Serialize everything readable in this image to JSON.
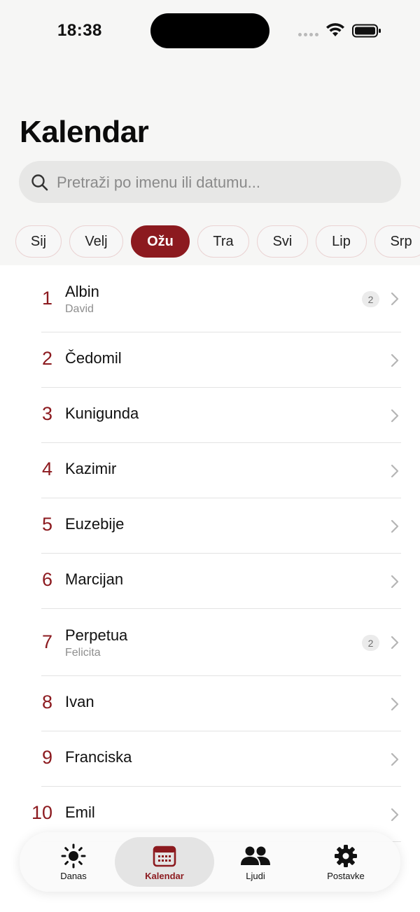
{
  "status": {
    "time": "18:38"
  },
  "header": {
    "title": "Kalendar"
  },
  "search": {
    "placeholder": "Pretraži po imenu ili datumu..."
  },
  "months": [
    {
      "label": "Sij",
      "active": false
    },
    {
      "label": "Velj",
      "active": false
    },
    {
      "label": "Ožu",
      "active": true
    },
    {
      "label": "Tra",
      "active": false
    },
    {
      "label": "Svi",
      "active": false
    },
    {
      "label": "Lip",
      "active": false
    },
    {
      "label": "Srp",
      "active": false
    }
  ],
  "days": [
    {
      "day": "1",
      "name": "Albin",
      "sub": "David",
      "badge": "2"
    },
    {
      "day": "2",
      "name": "Čedomil",
      "sub": "",
      "badge": ""
    },
    {
      "day": "3",
      "name": "Kunigunda",
      "sub": "",
      "badge": ""
    },
    {
      "day": "4",
      "name": "Kazimir",
      "sub": "",
      "badge": ""
    },
    {
      "day": "5",
      "name": "Euzebije",
      "sub": "",
      "badge": ""
    },
    {
      "day": "6",
      "name": "Marcijan",
      "sub": "",
      "badge": ""
    },
    {
      "day": "7",
      "name": "Perpetua",
      "sub": "Felicita",
      "badge": "2"
    },
    {
      "day": "8",
      "name": "Ivan",
      "sub": "",
      "badge": ""
    },
    {
      "day": "9",
      "name": "Franciska",
      "sub": "",
      "badge": ""
    },
    {
      "day": "10",
      "name": "Emil",
      "sub": "",
      "badge": ""
    }
  ],
  "tabs": [
    {
      "label": "Danas",
      "icon": "sun-icon",
      "active": false
    },
    {
      "label": "Kalendar",
      "icon": "calendar-icon",
      "active": true
    },
    {
      "label": "Ljudi",
      "icon": "people-icon",
      "active": false
    },
    {
      "label": "Postavke",
      "icon": "gear-icon",
      "active": false
    }
  ],
  "colors": {
    "accent": "#8c1a1f",
    "background": "#f6f6f5",
    "search_bg": "#e7e7e6"
  }
}
